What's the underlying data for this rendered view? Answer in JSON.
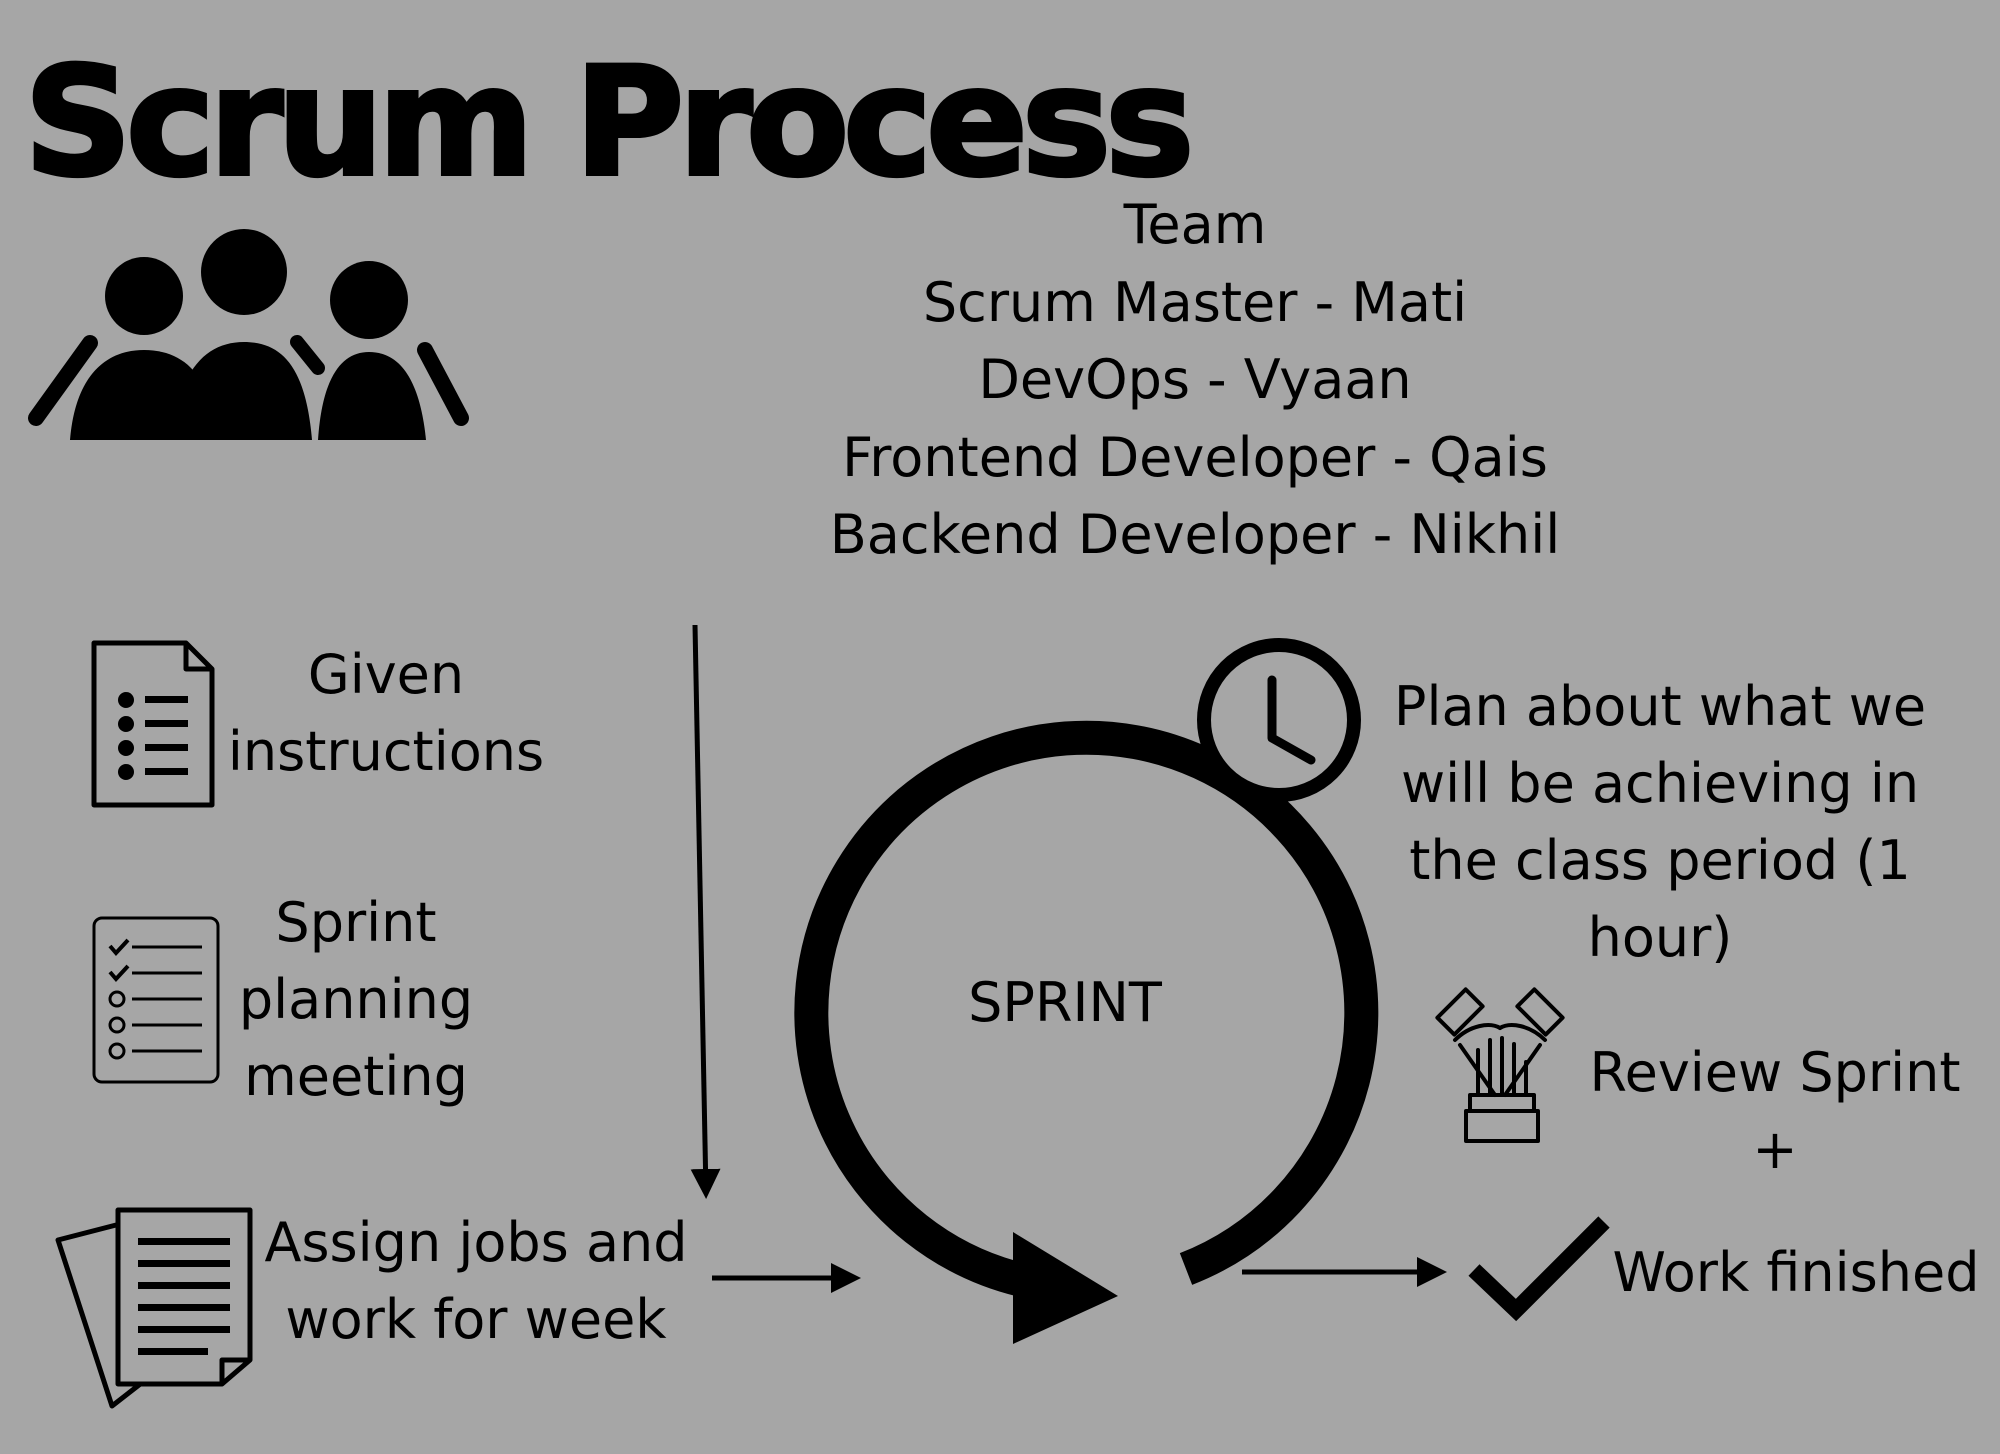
{
  "title": "Scrum Process",
  "team": {
    "heading": "Team",
    "members": [
      "Scrum Master - Mati",
      "DevOps - Vyaan",
      "Frontend Developer - Qais",
      "Backend Developer - Nikhil"
    ]
  },
  "steps": {
    "given_instructions": [
      "Given",
      "instructions"
    ],
    "sprint_planning": [
      "Sprint",
      "planning",
      "meeting"
    ],
    "assign_jobs": [
      "Assign jobs and",
      "work for week"
    ],
    "sprint": "SPRINT",
    "plan": [
      "Plan about what we",
      "will be achieving in",
      "the class period (1",
      "hour)"
    ],
    "review": [
      "Review Sprint",
      "+"
    ],
    "work_finished": "Work finished"
  },
  "icons": {
    "team": "people-group-icon",
    "instructions": "document-list-icon",
    "planning": "checklist-icon",
    "assign": "documents-stack-icon",
    "clock": "clock-icon",
    "review": "team-hands-icon",
    "done": "checkmark-icon"
  },
  "colors": {
    "background": "#a6a6a6",
    "foreground": "#000000"
  }
}
